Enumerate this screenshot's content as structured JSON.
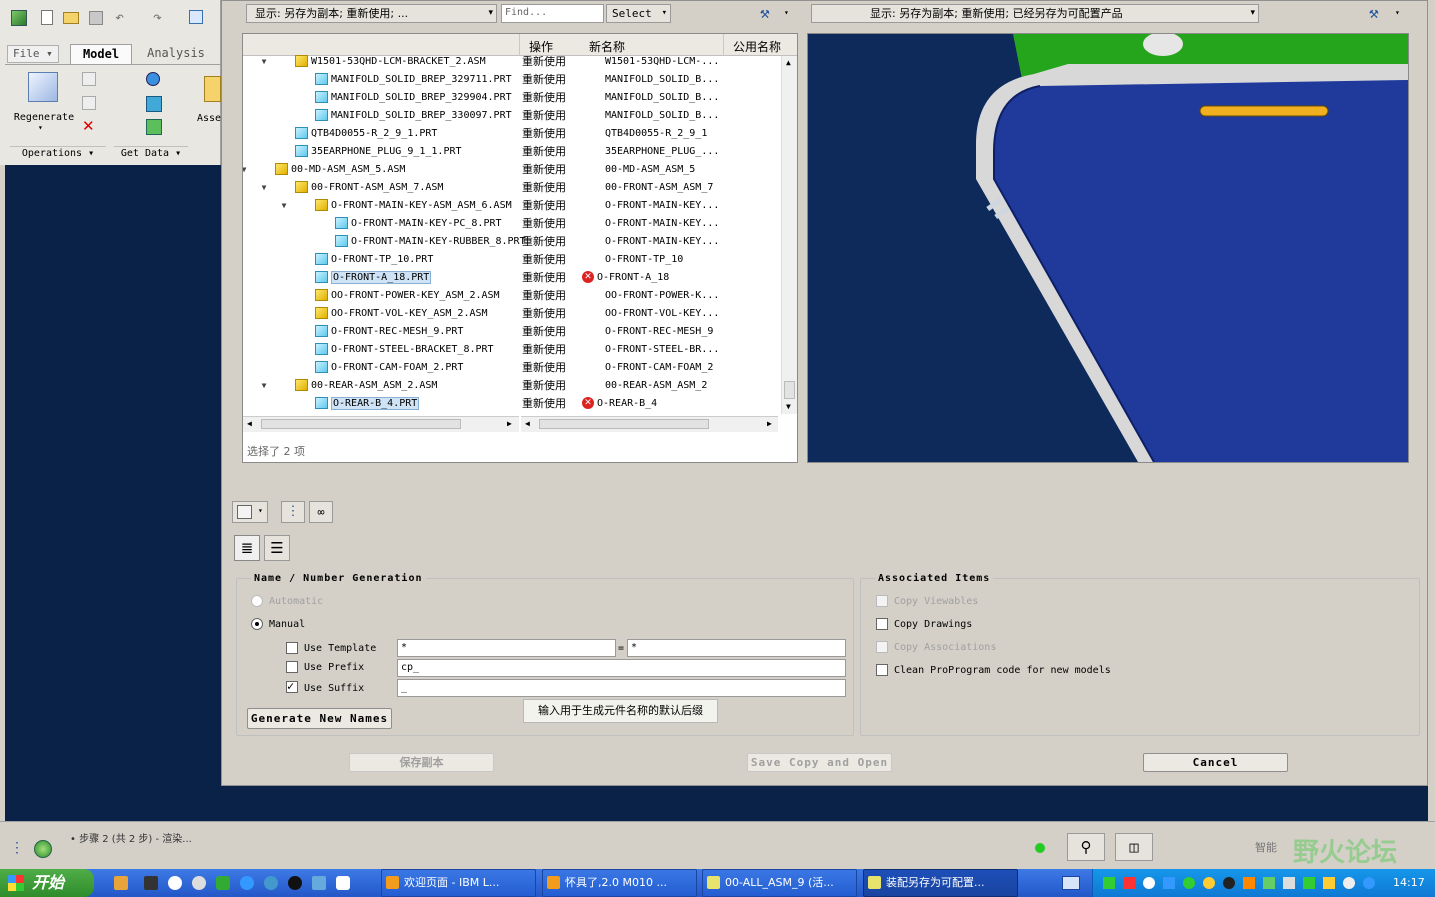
{
  "app_ribbon": {
    "tabs": [
      "File",
      "Model",
      "Analysis"
    ],
    "regenerate_label": "Regenerate",
    "assemble_label": "Asse",
    "group_operations": "Operations",
    "group_get_data": "Get Data"
  },
  "left_panel": {
    "display_dropdown": "显示: 另存为副本; 重新使用; ...",
    "find_placeholder": "Find...",
    "select_label": "Select",
    "columns": {
      "op": "操作",
      "new_name": "新名称",
      "common_name": "公用名称"
    },
    "status": "选择了 2 项",
    "rows": [
      {
        "name": "W1501-53QHD-LCM-BRACKET_2.ASM",
        "op": "重新使用",
        "new": "W1501-53QHD-LCM-...",
        "type": "asm",
        "indent": 1,
        "tri": "▼",
        "sel": false,
        "err": false
      },
      {
        "name": "MANIFOLD_SOLID_BREP_329711.PRT",
        "op": "重新使用",
        "new": "MANIFOLD_SOLID_B...",
        "type": "prt",
        "indent": 2,
        "tri": "",
        "sel": false,
        "err": false
      },
      {
        "name": "MANIFOLD_SOLID_BREP_329904.PRT",
        "op": "重新使用",
        "new": "MANIFOLD_SOLID_B...",
        "type": "prt",
        "indent": 2,
        "tri": "",
        "sel": false,
        "err": false
      },
      {
        "name": "MANIFOLD_SOLID_BREP_330097.PRT",
        "op": "重新使用",
        "new": "MANIFOLD_SOLID_B...",
        "type": "prt",
        "indent": 2,
        "tri": "",
        "sel": false,
        "err": false
      },
      {
        "name": "QTB4D0055-R_2_9_1.PRT",
        "op": "重新使用",
        "new": "QTB4D0055-R_2_9_1",
        "type": "prt",
        "indent": 1,
        "tri": "",
        "sel": false,
        "err": false
      },
      {
        "name": "35EARPHONE_PLUG_9_1_1.PRT",
        "op": "重新使用",
        "new": "35EARPHONE_PLUG_...",
        "type": "prt",
        "indent": 1,
        "tri": "",
        "sel": false,
        "err": false
      },
      {
        "name": "00-MD-ASM_ASM_5.ASM",
        "op": "重新使用",
        "new": "00-MD-ASM_ASM_5",
        "type": "asm",
        "indent": 0,
        "tri": "▼",
        "sel": false,
        "err": false
      },
      {
        "name": "00-FRONT-ASM_ASM_7.ASM",
        "op": "重新使用",
        "new": "00-FRONT-ASM_ASM_7",
        "type": "asm",
        "indent": 1,
        "tri": "▼",
        "sel": false,
        "err": false
      },
      {
        "name": "O-FRONT-MAIN-KEY-ASM_ASM_6.ASM",
        "op": "重新使用",
        "new": "O-FRONT-MAIN-KEY...",
        "type": "asm",
        "indent": 2,
        "tri": "▼",
        "sel": false,
        "err": false
      },
      {
        "name": "O-FRONT-MAIN-KEY-PC_8.PRT",
        "op": "重新使用",
        "new": "O-FRONT-MAIN-KEY...",
        "type": "prt",
        "indent": 3,
        "tri": "",
        "sel": false,
        "err": false
      },
      {
        "name": "O-FRONT-MAIN-KEY-RUBBER_8.PRT",
        "op": "重新使用",
        "new": "O-FRONT-MAIN-KEY...",
        "type": "prt",
        "indent": 3,
        "tri": "",
        "sel": false,
        "err": false
      },
      {
        "name": "O-FRONT-TP_10.PRT",
        "op": "重新使用",
        "new": "O-FRONT-TP_10",
        "type": "prt",
        "indent": 2,
        "tri": "",
        "sel": false,
        "err": false
      },
      {
        "name": "O-FRONT-A_18.PRT",
        "op": "重新使用",
        "new": "O-FRONT-A_18",
        "type": "prt",
        "indent": 2,
        "tri": "",
        "sel": true,
        "err": true
      },
      {
        "name": "OO-FRONT-POWER-KEY_ASM_2.ASM",
        "op": "重新使用",
        "new": "OO-FRONT-POWER-K...",
        "type": "asm",
        "indent": 2,
        "tri": "",
        "sel": false,
        "err": false
      },
      {
        "name": "OO-FRONT-VOL-KEY_ASM_2.ASM",
        "op": "重新使用",
        "new": "OO-FRONT-VOL-KEY...",
        "type": "asm",
        "indent": 2,
        "tri": "",
        "sel": false,
        "err": false
      },
      {
        "name": "O-FRONT-REC-MESH_9.PRT",
        "op": "重新使用",
        "new": "O-FRONT-REC-MESH_9",
        "type": "prt",
        "indent": 2,
        "tri": "",
        "sel": false,
        "err": false
      },
      {
        "name": "O-FRONT-STEEL-BRACKET_8.PRT",
        "op": "重新使用",
        "new": "O-FRONT-STEEL-BR...",
        "type": "prt",
        "indent": 2,
        "tri": "",
        "sel": false,
        "err": false
      },
      {
        "name": "O-FRONT-CAM-FOAM_2.PRT",
        "op": "重新使用",
        "new": "O-FRONT-CAM-FOAM_2",
        "type": "prt",
        "indent": 2,
        "tri": "",
        "sel": false,
        "err": false
      },
      {
        "name": "00-REAR-ASM_ASM_2.ASM",
        "op": "重新使用",
        "new": "00-REAR-ASM_ASM_2",
        "type": "asm",
        "indent": 1,
        "tri": "▼",
        "sel": false,
        "err": false
      },
      {
        "name": "O-REAR-B_4.PRT",
        "op": "重新使用",
        "new": "O-REAR-B_4",
        "type": "prt",
        "indent": 2,
        "tri": "",
        "sel": true,
        "err": true
      }
    ]
  },
  "right_panel": {
    "display_dropdown": "显示: 另存为副本; 重新使用; 已经另存为可配置产品"
  },
  "options": {
    "name_group": "Name / Number Generation",
    "automatic": "Automatic",
    "manual": "Manual",
    "use_template": "Use Template",
    "use_prefix": "Use Prefix",
    "use_suffix": "Use Suffix",
    "template_left": "*",
    "template_equals": "=",
    "template_right": "*",
    "prefix_value": "cp_",
    "suffix_value": "_",
    "generate_button": "Generate New Names",
    "tooltip": "输入用于生成元件名称的默认后缀",
    "assoc_group": "Associated Items",
    "copy_viewables": "Copy Viewables",
    "copy_drawings": "Copy Drawings",
    "copy_associations": "Copy Associations",
    "clean_proprogram": "Clean ProProgram code for new models"
  },
  "footer_buttons": {
    "save_copy": "保存副本",
    "save_copy_open": "Save Copy and Open",
    "cancel": "Cancel"
  },
  "status_bar": {
    "message": "• 步骤 2 (共 2 步) - 渲染...",
    "smart_label": "智能",
    "watermark": "野火论坛"
  },
  "taskbar": {
    "start": "开始",
    "items": [
      "欢迎页面 - IBM L...",
      "怀具了,2.0 M010 ...",
      "00-ALL_ASM_9 (活...",
      "装配另存为可配置..."
    ],
    "clock": "14:17"
  },
  "colors": {
    "viewport_bg": "#0d2a5a",
    "model_blue": "#1f3a9a",
    "model_green": "#25a51c",
    "taskbar_blue": "#245dd1",
    "start_green": "#3d9b35"
  }
}
